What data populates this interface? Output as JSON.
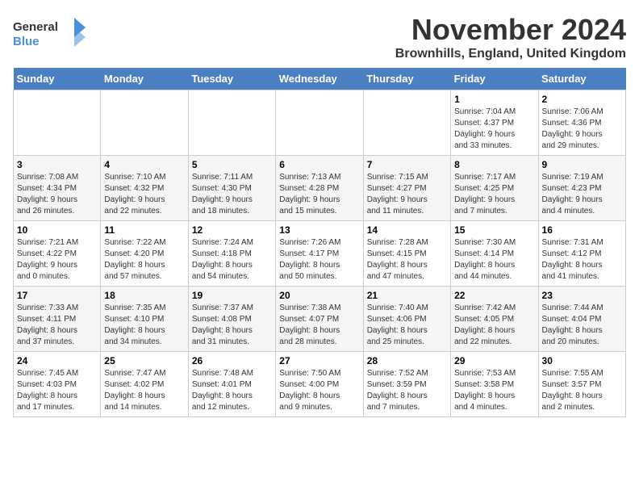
{
  "header": {
    "logo_line1": "General",
    "logo_line2": "Blue",
    "month": "November 2024",
    "location": "Brownhills, England, United Kingdom"
  },
  "days_of_week": [
    "Sunday",
    "Monday",
    "Tuesday",
    "Wednesday",
    "Thursday",
    "Friday",
    "Saturday"
  ],
  "weeks": [
    [
      {
        "num": "",
        "info": ""
      },
      {
        "num": "",
        "info": ""
      },
      {
        "num": "",
        "info": ""
      },
      {
        "num": "",
        "info": ""
      },
      {
        "num": "",
        "info": ""
      },
      {
        "num": "1",
        "info": "Sunrise: 7:04 AM\nSunset: 4:37 PM\nDaylight: 9 hours\nand 33 minutes."
      },
      {
        "num": "2",
        "info": "Sunrise: 7:06 AM\nSunset: 4:36 PM\nDaylight: 9 hours\nand 29 minutes."
      }
    ],
    [
      {
        "num": "3",
        "info": "Sunrise: 7:08 AM\nSunset: 4:34 PM\nDaylight: 9 hours\nand 26 minutes."
      },
      {
        "num": "4",
        "info": "Sunrise: 7:10 AM\nSunset: 4:32 PM\nDaylight: 9 hours\nand 22 minutes."
      },
      {
        "num": "5",
        "info": "Sunrise: 7:11 AM\nSunset: 4:30 PM\nDaylight: 9 hours\nand 18 minutes."
      },
      {
        "num": "6",
        "info": "Sunrise: 7:13 AM\nSunset: 4:28 PM\nDaylight: 9 hours\nand 15 minutes."
      },
      {
        "num": "7",
        "info": "Sunrise: 7:15 AM\nSunset: 4:27 PM\nDaylight: 9 hours\nand 11 minutes."
      },
      {
        "num": "8",
        "info": "Sunrise: 7:17 AM\nSunset: 4:25 PM\nDaylight: 9 hours\nand 7 minutes."
      },
      {
        "num": "9",
        "info": "Sunrise: 7:19 AM\nSunset: 4:23 PM\nDaylight: 9 hours\nand 4 minutes."
      }
    ],
    [
      {
        "num": "10",
        "info": "Sunrise: 7:21 AM\nSunset: 4:22 PM\nDaylight: 9 hours\nand 0 minutes."
      },
      {
        "num": "11",
        "info": "Sunrise: 7:22 AM\nSunset: 4:20 PM\nDaylight: 8 hours\nand 57 minutes."
      },
      {
        "num": "12",
        "info": "Sunrise: 7:24 AM\nSunset: 4:18 PM\nDaylight: 8 hours\nand 54 minutes."
      },
      {
        "num": "13",
        "info": "Sunrise: 7:26 AM\nSunset: 4:17 PM\nDaylight: 8 hours\nand 50 minutes."
      },
      {
        "num": "14",
        "info": "Sunrise: 7:28 AM\nSunset: 4:15 PM\nDaylight: 8 hours\nand 47 minutes."
      },
      {
        "num": "15",
        "info": "Sunrise: 7:30 AM\nSunset: 4:14 PM\nDaylight: 8 hours\nand 44 minutes."
      },
      {
        "num": "16",
        "info": "Sunrise: 7:31 AM\nSunset: 4:12 PM\nDaylight: 8 hours\nand 41 minutes."
      }
    ],
    [
      {
        "num": "17",
        "info": "Sunrise: 7:33 AM\nSunset: 4:11 PM\nDaylight: 8 hours\nand 37 minutes."
      },
      {
        "num": "18",
        "info": "Sunrise: 7:35 AM\nSunset: 4:10 PM\nDaylight: 8 hours\nand 34 minutes."
      },
      {
        "num": "19",
        "info": "Sunrise: 7:37 AM\nSunset: 4:08 PM\nDaylight: 8 hours\nand 31 minutes."
      },
      {
        "num": "20",
        "info": "Sunrise: 7:38 AM\nSunset: 4:07 PM\nDaylight: 8 hours\nand 28 minutes."
      },
      {
        "num": "21",
        "info": "Sunrise: 7:40 AM\nSunset: 4:06 PM\nDaylight: 8 hours\nand 25 minutes."
      },
      {
        "num": "22",
        "info": "Sunrise: 7:42 AM\nSunset: 4:05 PM\nDaylight: 8 hours\nand 22 minutes."
      },
      {
        "num": "23",
        "info": "Sunrise: 7:44 AM\nSunset: 4:04 PM\nDaylight: 8 hours\nand 20 minutes."
      }
    ],
    [
      {
        "num": "24",
        "info": "Sunrise: 7:45 AM\nSunset: 4:03 PM\nDaylight: 8 hours\nand 17 minutes."
      },
      {
        "num": "25",
        "info": "Sunrise: 7:47 AM\nSunset: 4:02 PM\nDaylight: 8 hours\nand 14 minutes."
      },
      {
        "num": "26",
        "info": "Sunrise: 7:48 AM\nSunset: 4:01 PM\nDaylight: 8 hours\nand 12 minutes."
      },
      {
        "num": "27",
        "info": "Sunrise: 7:50 AM\nSunset: 4:00 PM\nDaylight: 8 hours\nand 9 minutes."
      },
      {
        "num": "28",
        "info": "Sunrise: 7:52 AM\nSunset: 3:59 PM\nDaylight: 8 hours\nand 7 minutes."
      },
      {
        "num": "29",
        "info": "Sunrise: 7:53 AM\nSunset: 3:58 PM\nDaylight: 8 hours\nand 4 minutes."
      },
      {
        "num": "30",
        "info": "Sunrise: 7:55 AM\nSunset: 3:57 PM\nDaylight: 8 hours\nand 2 minutes."
      }
    ]
  ]
}
